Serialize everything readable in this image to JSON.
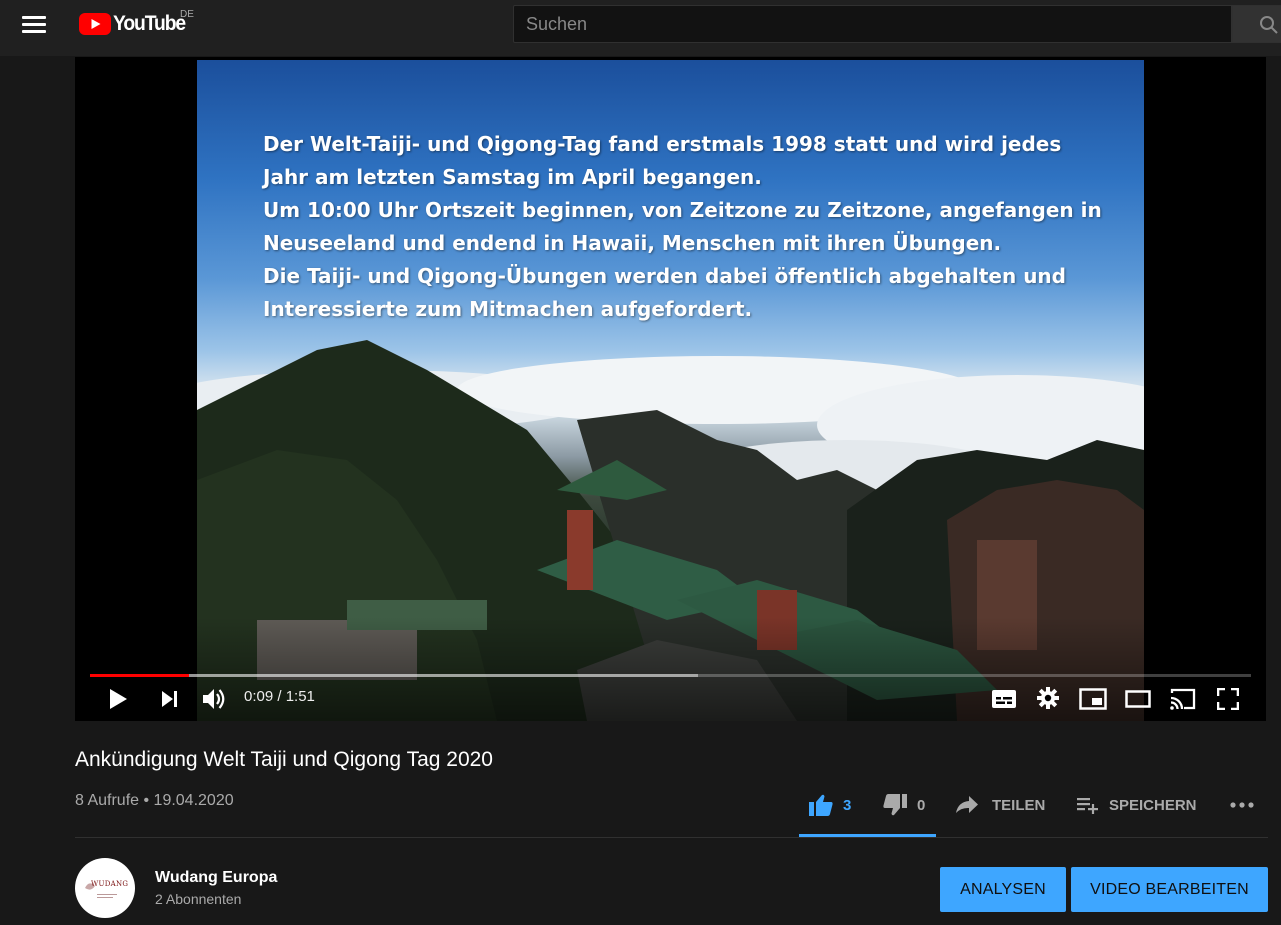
{
  "header": {
    "logo_text": "YouTube",
    "country_code": "DE",
    "search_placeholder": "Suchen"
  },
  "video": {
    "slide_lines": [
      "Der Welt-Taiji- und Qigong-Tag fand erstmals 1998 statt und wird jedes",
      "Jahr am letzten Samstag im April begangen.",
      "Um 10:00 Uhr Ortszeit beginnen, von Zeitzone zu Zeitzone, angefangen in",
      "Neuseeland und endend in Hawaii, Menschen mit ihren Übungen.",
      "Die Taiji- und Qigong-Übungen werden dabei öffentlich abgehalten und",
      "Interessierte zum Mitmachen aufgefordert."
    ],
    "time_display": "0:09 / 1:51",
    "played_fraction": 0.085,
    "buffered_fraction": 0.524
  },
  "info": {
    "title": "Ankündigung Welt Taiji und Qigong Tag 2020",
    "meta": "8 Aufrufe • 19.04.2020",
    "like_count": "3",
    "dislike_count": "0",
    "share_label": "TEILEN",
    "save_label": "SPEICHERN"
  },
  "channel": {
    "name": "Wudang Europa",
    "subscribers": "2 Abonnenten",
    "avatar_text": "WUDANG",
    "analytics_label": "ANALYSEN",
    "edit_label": "VIDEO BEARBEITEN"
  },
  "colors": {
    "accent_blue": "#3ea6ff",
    "progress_red": "#ff0000",
    "background": "#181818",
    "topbar": "#202020"
  },
  "icons": [
    "menu-icon",
    "youtube-logo-icon",
    "search-icon",
    "play-icon",
    "next-icon",
    "volume-icon",
    "subtitles-icon",
    "settings-icon",
    "miniplayer-icon",
    "theater-icon",
    "cast-icon",
    "fullscreen-icon",
    "thumb-up-icon",
    "thumb-down-icon",
    "share-icon",
    "playlist-add-icon",
    "more-icon"
  ]
}
